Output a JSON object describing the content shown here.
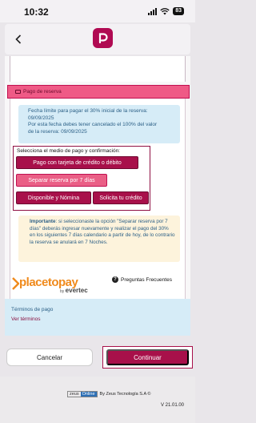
{
  "status_bar": {
    "time": "10:32",
    "battery": "83"
  },
  "header": {
    "back_icon": "chevron-left-icon",
    "logo_icon": "app-logo-p-icon"
  },
  "payment_section": {
    "header_icon": "credit-card-icon",
    "title": "Pago de reserva",
    "info_lines": [
      "Fecha límite para pagar el 30% inicial de la reserva:",
      "09/09/2025",
      "Por esta fecha debes tener cancelado el 100% del valor",
      "de la reserva:  09/09/2025"
    ],
    "method_title": "Selecciona el medio de pago y confirmación:",
    "methods": [
      "Pago con tarjeta de crédito o débito",
      "Separar reserva por 7 días",
      "Disponible y Nómina",
      "Solicita tu crédito"
    ],
    "note_label": "Importante",
    "note_text": ": si seleccionaste la opción \"Separar reserva por 7 días\" deberás ingresar nuevamente y realizar el pago del 30% en los siguientes 7 días calendario a partir de hoy, de lo contrario la reserva se anulará en  7 Noches."
  },
  "placetopay": {
    "logo_text": "placetopay",
    "by_text": "by",
    "evertec_text": "evertec",
    "faq_label": "Preguntas Frecuentes",
    "faq_icon": "question-circle-icon"
  },
  "terms": {
    "title": "Términos de pago",
    "link": "Ver términos"
  },
  "actions": {
    "cancel": "Cancelar",
    "continue": "Continuar"
  },
  "footer": {
    "zeus": "zeus",
    "online": "Online",
    "powered_by": "By Zeus Tecnología S.A ©",
    "version": "V 21.01.00"
  },
  "colors": {
    "brand": "#a8104a",
    "brand_light": "#ea5f86",
    "info_bg": "#d6ecf7",
    "warning_bg": "#fdf3dc",
    "placetopay_orange": "#f08a1c"
  }
}
